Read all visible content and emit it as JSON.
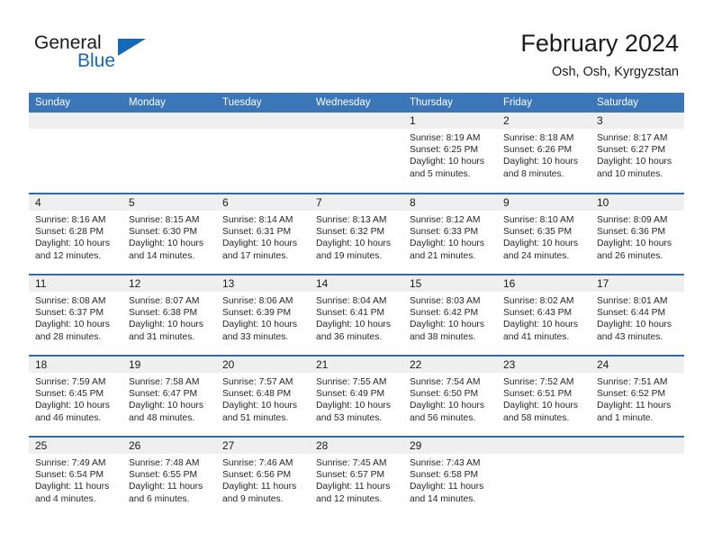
{
  "brand": {
    "name_part1": "General",
    "name_part2": "Blue",
    "accent_color": "#1469b6"
  },
  "header": {
    "title": "February 2024",
    "location": "Osh, Osh, Kyrgyzstan",
    "header_bg_color": "#3a76b8",
    "row_border_color": "#2e6cab",
    "daynum_bg_color": "#efefef"
  },
  "weekdays": [
    "Sunday",
    "Monday",
    "Tuesday",
    "Wednesday",
    "Thursday",
    "Friday",
    "Saturday"
  ],
  "labels": {
    "sunrise": "Sunrise:",
    "sunset": "Sunset:",
    "daylight": "Daylight:"
  },
  "weeks": [
    [
      {
        "day": "",
        "empty": true
      },
      {
        "day": "",
        "empty": true
      },
      {
        "day": "",
        "empty": true
      },
      {
        "day": "",
        "empty": true
      },
      {
        "day": "1",
        "sunrise": "Sunrise: 8:19 AM",
        "sunset": "Sunset: 6:25 PM",
        "daylight": "Daylight: 10 hours and 5 minutes."
      },
      {
        "day": "2",
        "sunrise": "Sunrise: 8:18 AM",
        "sunset": "Sunset: 6:26 PM",
        "daylight": "Daylight: 10 hours and 8 minutes."
      },
      {
        "day": "3",
        "sunrise": "Sunrise: 8:17 AM",
        "sunset": "Sunset: 6:27 PM",
        "daylight": "Daylight: 10 hours and 10 minutes."
      }
    ],
    [
      {
        "day": "4",
        "sunrise": "Sunrise: 8:16 AM",
        "sunset": "Sunset: 6:28 PM",
        "daylight": "Daylight: 10 hours and 12 minutes."
      },
      {
        "day": "5",
        "sunrise": "Sunrise: 8:15 AM",
        "sunset": "Sunset: 6:30 PM",
        "daylight": "Daylight: 10 hours and 14 minutes."
      },
      {
        "day": "6",
        "sunrise": "Sunrise: 8:14 AM",
        "sunset": "Sunset: 6:31 PM",
        "daylight": "Daylight: 10 hours and 17 minutes."
      },
      {
        "day": "7",
        "sunrise": "Sunrise: 8:13 AM",
        "sunset": "Sunset: 6:32 PM",
        "daylight": "Daylight: 10 hours and 19 minutes."
      },
      {
        "day": "8",
        "sunrise": "Sunrise: 8:12 AM",
        "sunset": "Sunset: 6:33 PM",
        "daylight": "Daylight: 10 hours and 21 minutes."
      },
      {
        "day": "9",
        "sunrise": "Sunrise: 8:10 AM",
        "sunset": "Sunset: 6:35 PM",
        "daylight": "Daylight: 10 hours and 24 minutes."
      },
      {
        "day": "10",
        "sunrise": "Sunrise: 8:09 AM",
        "sunset": "Sunset: 6:36 PM",
        "daylight": "Daylight: 10 hours and 26 minutes."
      }
    ],
    [
      {
        "day": "11",
        "sunrise": "Sunrise: 8:08 AM",
        "sunset": "Sunset: 6:37 PM",
        "daylight": "Daylight: 10 hours and 28 minutes."
      },
      {
        "day": "12",
        "sunrise": "Sunrise: 8:07 AM",
        "sunset": "Sunset: 6:38 PM",
        "daylight": "Daylight: 10 hours and 31 minutes."
      },
      {
        "day": "13",
        "sunrise": "Sunrise: 8:06 AM",
        "sunset": "Sunset: 6:39 PM",
        "daylight": "Daylight: 10 hours and 33 minutes."
      },
      {
        "day": "14",
        "sunrise": "Sunrise: 8:04 AM",
        "sunset": "Sunset: 6:41 PM",
        "daylight": "Daylight: 10 hours and 36 minutes."
      },
      {
        "day": "15",
        "sunrise": "Sunrise: 8:03 AM",
        "sunset": "Sunset: 6:42 PM",
        "daylight": "Daylight: 10 hours and 38 minutes."
      },
      {
        "day": "16",
        "sunrise": "Sunrise: 8:02 AM",
        "sunset": "Sunset: 6:43 PM",
        "daylight": "Daylight: 10 hours and 41 minutes."
      },
      {
        "day": "17",
        "sunrise": "Sunrise: 8:01 AM",
        "sunset": "Sunset: 6:44 PM",
        "daylight": "Daylight: 10 hours and 43 minutes."
      }
    ],
    [
      {
        "day": "18",
        "sunrise": "Sunrise: 7:59 AM",
        "sunset": "Sunset: 6:45 PM",
        "daylight": "Daylight: 10 hours and 46 minutes."
      },
      {
        "day": "19",
        "sunrise": "Sunrise: 7:58 AM",
        "sunset": "Sunset: 6:47 PM",
        "daylight": "Daylight: 10 hours and 48 minutes."
      },
      {
        "day": "20",
        "sunrise": "Sunrise: 7:57 AM",
        "sunset": "Sunset: 6:48 PM",
        "daylight": "Daylight: 10 hours and 51 minutes."
      },
      {
        "day": "21",
        "sunrise": "Sunrise: 7:55 AM",
        "sunset": "Sunset: 6:49 PM",
        "daylight": "Daylight: 10 hours and 53 minutes."
      },
      {
        "day": "22",
        "sunrise": "Sunrise: 7:54 AM",
        "sunset": "Sunset: 6:50 PM",
        "daylight": "Daylight: 10 hours and 56 minutes."
      },
      {
        "day": "23",
        "sunrise": "Sunrise: 7:52 AM",
        "sunset": "Sunset: 6:51 PM",
        "daylight": "Daylight: 10 hours and 58 minutes."
      },
      {
        "day": "24",
        "sunrise": "Sunrise: 7:51 AM",
        "sunset": "Sunset: 6:52 PM",
        "daylight": "Daylight: 11 hours and 1 minute."
      }
    ],
    [
      {
        "day": "25",
        "sunrise": "Sunrise: 7:49 AM",
        "sunset": "Sunset: 6:54 PM",
        "daylight": "Daylight: 11 hours and 4 minutes."
      },
      {
        "day": "26",
        "sunrise": "Sunrise: 7:48 AM",
        "sunset": "Sunset: 6:55 PM",
        "daylight": "Daylight: 11 hours and 6 minutes."
      },
      {
        "day": "27",
        "sunrise": "Sunrise: 7:46 AM",
        "sunset": "Sunset: 6:56 PM",
        "daylight": "Daylight: 11 hours and 9 minutes."
      },
      {
        "day": "28",
        "sunrise": "Sunrise: 7:45 AM",
        "sunset": "Sunset: 6:57 PM",
        "daylight": "Daylight: 11 hours and 12 minutes."
      },
      {
        "day": "29",
        "sunrise": "Sunrise: 7:43 AM",
        "sunset": "Sunset: 6:58 PM",
        "daylight": "Daylight: 11 hours and 14 minutes."
      },
      {
        "day": "",
        "empty": true
      },
      {
        "day": "",
        "empty": true
      }
    ]
  ]
}
